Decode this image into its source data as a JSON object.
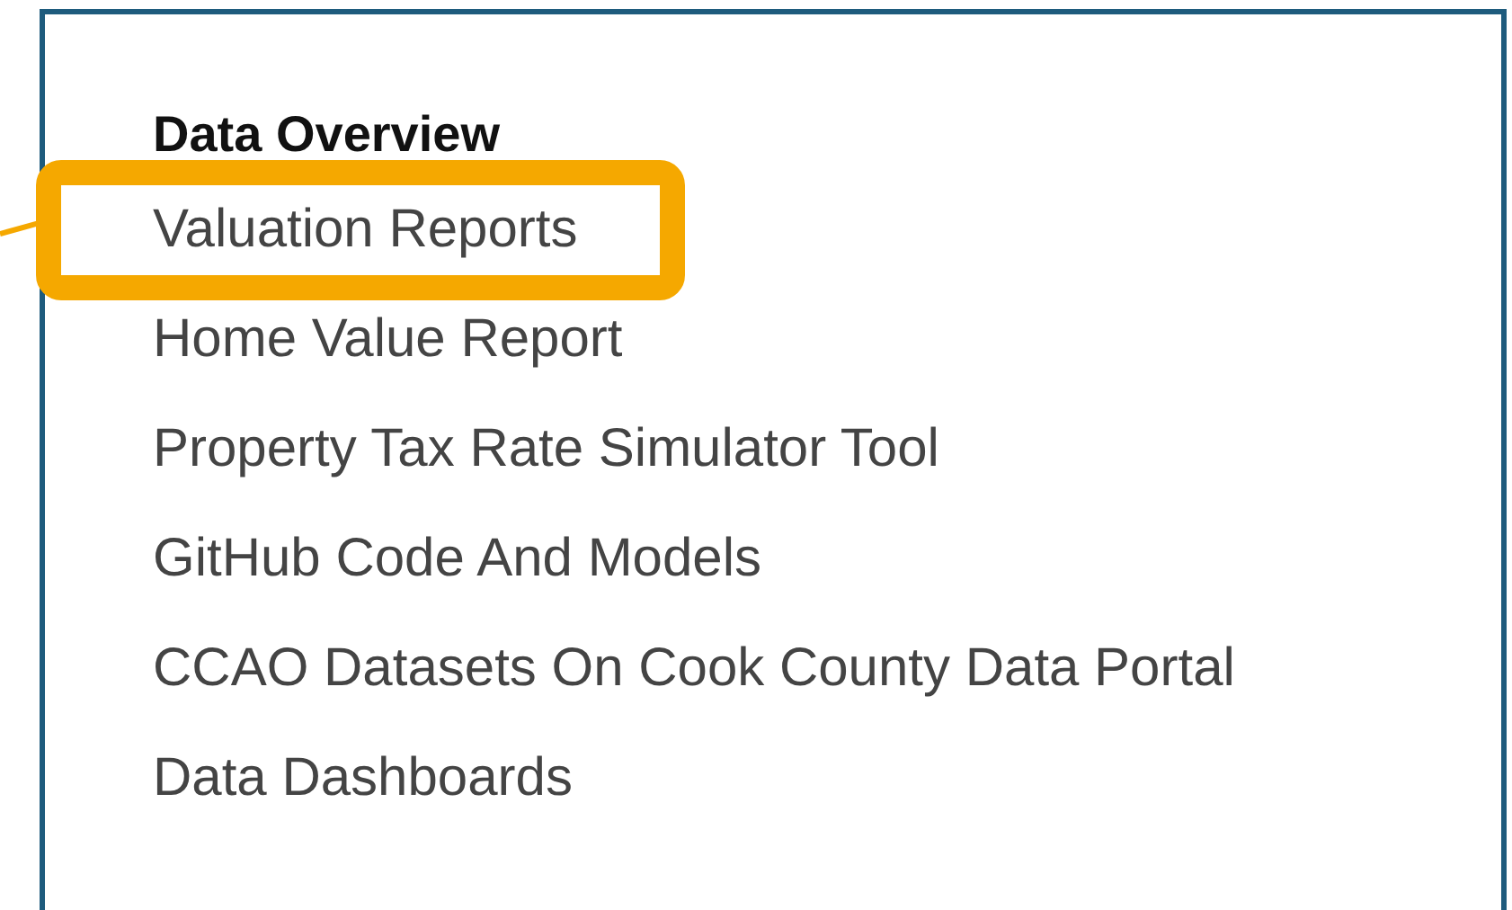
{
  "panel": {
    "heading": "Data Overview",
    "links": [
      {
        "label": "Valuation Reports",
        "highlighted": true
      },
      {
        "label": "Home Value Report",
        "highlighted": false
      },
      {
        "label": "Property Tax Rate Simulator Tool",
        "highlighted": false
      },
      {
        "label": "GitHub Code And Models",
        "highlighted": false
      },
      {
        "label": "CCAO Datasets On Cook County Data Portal",
        "highlighted": false
      },
      {
        "label": "Data Dashboards",
        "highlighted": false
      }
    ]
  }
}
